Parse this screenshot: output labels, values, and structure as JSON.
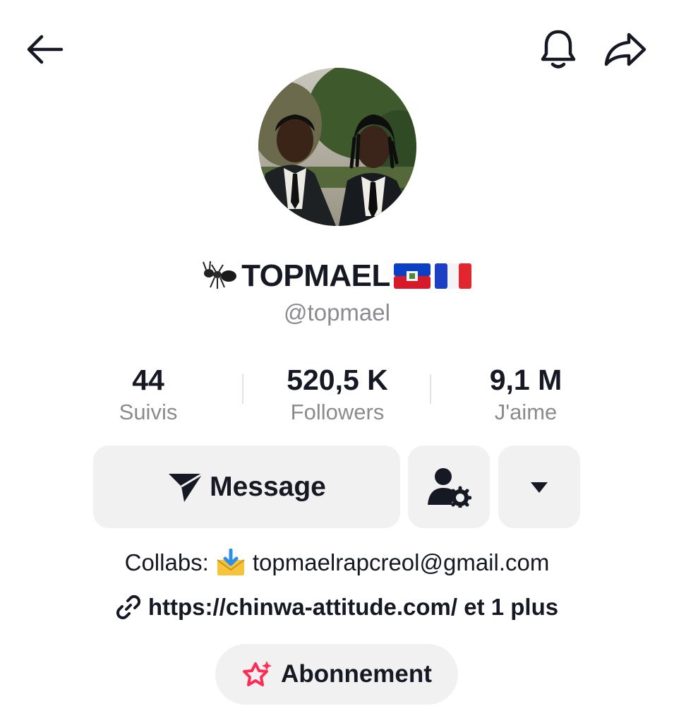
{
  "topbar": {
    "back_icon": "arrow-left-icon",
    "bell_icon": "bell-icon",
    "share_icon": "share-arrow-icon"
  },
  "profile": {
    "avatar_alt": "profile-photo",
    "display_name": "TOPMAEL",
    "name_prefix_icon": "ant-emoji-icon",
    "name_suffix_icons": [
      "haiti-flag-icon",
      "france-flag-icon"
    ],
    "handle": "@topmael"
  },
  "stats": [
    {
      "value": "44",
      "label": "Suivis"
    },
    {
      "value": "520,5 K",
      "label": "Followers"
    },
    {
      "value": "9,1 M",
      "label": "J'aime"
    }
  ],
  "actions": {
    "message_label": "Message",
    "message_icon": "paper-plane-icon",
    "friends_icon": "user-settings-icon",
    "more_icon": "caret-down-icon"
  },
  "bio": {
    "prefix": "Collabs:",
    "email_icon": "incoming-envelope-icon",
    "email": "topmaelrapcreol@gmail.com"
  },
  "link": {
    "icon": "link-icon",
    "text": "https://chinwa-attitude.com/ et 1 plus"
  },
  "subscription": {
    "icon": "star-sparkle-icon",
    "label": "Abonnement"
  },
  "colors": {
    "primary_text": "#161823",
    "secondary_text": "#8a8b91",
    "button_bg": "#f1f1f2",
    "accent_pink": "#fe2c55"
  }
}
